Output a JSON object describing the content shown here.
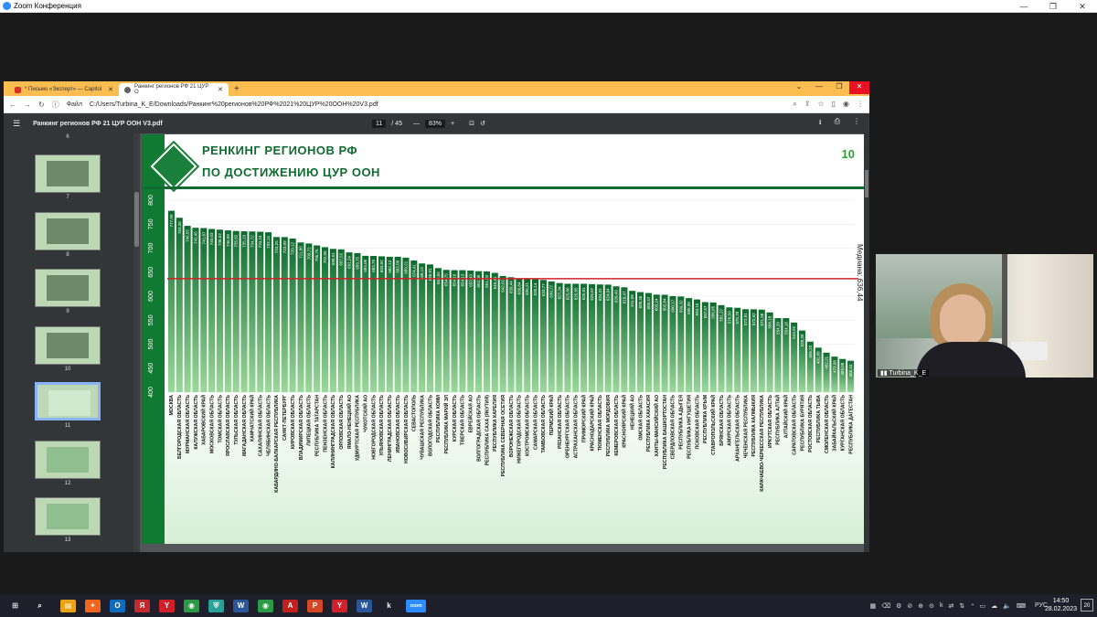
{
  "zoom_window": {
    "title": "Zoom Конференция",
    "min": "—",
    "max": "❐",
    "close": "✕"
  },
  "browser": {
    "tabs": [
      {
        "label": "* Письмо «Эксперт» — Capitol",
        "active": false,
        "color": "#d93025"
      },
      {
        "label": "Ранкинг регионов РФ 21 ЦУР О",
        "active": true,
        "color": "#5f6368"
      }
    ],
    "new_tab": "+",
    "address": {
      "scheme": "Файл",
      "url": "C:/Users/Turbina_K_E/Downloads/Ранкинг%20регионов%20РФ%2021%20ЦУР%20ООН%20V3.pdf"
    }
  },
  "pdf_toolbar": {
    "menu": "☰",
    "filename": "Ранкинг регионов РФ 21 ЦУР ООН V3.pdf",
    "page_current": "11",
    "page_total": "/ 45",
    "zoom_out": "—",
    "zoom": "83%",
    "zoom_in": "+",
    "download": "⭳",
    "print": "⎙",
    "more": "⋮"
  },
  "thumbnails": [
    {
      "label": "6",
      "top": true
    },
    {
      "label": "7"
    },
    {
      "label": "8"
    },
    {
      "label": "9"
    },
    {
      "label": "10"
    },
    {
      "label": "11",
      "active": true
    },
    {
      "label": "12"
    },
    {
      "label": "13"
    }
  ],
  "page": {
    "title_line1": "РЕНКИНГ РЕГИОНОВ РФ",
    "title_line2": "ПО ДОСТИЖЕНИЮ ЦУР ООН",
    "page_number": "10",
    "median_label": "Медиана: 636,44"
  },
  "chart_data": {
    "type": "bar",
    "ylim": [
      400,
      800
    ],
    "yticks": [
      400,
      450,
      500,
      550,
      600,
      650,
      700,
      750,
      800
    ],
    "median": 636.44,
    "colors": {
      "bar_top": "#0d6b2c",
      "bar_bottom": "#9ad99a",
      "median": "#d0202a"
    },
    "categories": [
      "МОСКВА",
      "БЕЛГОРОДСКАЯ ОБЛАСТЬ",
      "МУРМАНСКАЯ ОБЛАСТЬ",
      "КАЛУЖСКАЯ ОБЛАСТЬ",
      "ХАБАРОВСКИЙ КРАЙ",
      "МОСКОВСКАЯ ОБЛАСТЬ",
      "ТОМСКАЯ ОБЛАСТЬ",
      "ЯРОСЛАВСКАЯ ОБЛАСТЬ",
      "ТУЛЬСКАЯ ОБЛАСТЬ",
      "МАГАДАНСКАЯ ОБЛАСТЬ",
      "КАМЧАТСКИЙ КРАЙ",
      "САХАЛИНСКАЯ ОБЛАСТЬ",
      "ЧЕЛЯБИНСКАЯ ОБЛАСТЬ",
      "КАБАРДИНО-БАЛКАРСКАЯ РЕСПУБЛИКА",
      "САНКТ-ПЕТЕРБУРГ",
      "КИРОВСКАЯ ОБЛАСТЬ",
      "ВЛАДИМИРСКАЯ ОБЛАСТЬ",
      "ЛИПЕЦКАЯ ОБЛАСТЬ",
      "РЕСПУБЛИКА ТАТАРСТАН",
      "ПЕНЗЕНСКАЯ ОБЛАСТЬ",
      "КАЛИНИНГРАДСКАЯ ОБЛАСТЬ",
      "ОРЛОВСКАЯ ОБЛАСТЬ",
      "ЯМАЛО-НЕНЕЦКИЙ АО",
      "УДМУРТСКАЯ РЕСПУБЛИКА",
      "ЧУКОТСКИЙ АО",
      "НОВГОРОДСКАЯ ОБЛАСТЬ",
      "УЛЬЯНОВСКАЯ ОБЛАСТЬ",
      "ЛЕНИНГРАДСКАЯ ОБЛАСТЬ",
      "ИВАНОВСКАЯ ОБЛАСТЬ",
      "НОВОСИБИРСКАЯ ОБЛАСТЬ",
      "СЕВАСТОПОЛЬ",
      "ЧУВАШСКАЯ РЕСПУБЛИКА",
      "ВОЛОГОДСКАЯ ОБЛАСТЬ",
      "РЕСПУБЛИКА КОМИ",
      "РЕСПУБЛИКА МАРИЙ ЭЛ",
      "КУРСКАЯ ОБЛАСТЬ",
      "ТВЕРСКАЯ ОБЛАСТЬ",
      "ЕВРЕЙСКАЯ АО",
      "ВОЛГОГРАДСКАЯ ОБЛАСТЬ",
      "РЕСПУБЛИКА САХА (ЯКУТИЯ)",
      "РЕСПУБЛИКА КАРЕЛИЯ",
      "РЕСПУБЛИКА СЕВЕРНАЯ ОСЕТИЯ",
      "ВОРОНЕЖСКАЯ ОБЛАСТЬ",
      "НИЖЕГОРОДСКАЯ ОБЛАСТЬ",
      "КОСТРОМСКАЯ ОБЛАСТЬ",
      "САМАРСКАЯ ОБЛАСТЬ",
      "ТАМБОВСКАЯ ОБЛАСТЬ",
      "ПЕРМСКИЙ КРАЙ",
      "РЯЗАНСКАЯ ОБЛАСТЬ",
      "ОРЕНБУРГСКАЯ ОБЛАСТЬ",
      "АСТРАХАНСКАЯ ОБЛАСТЬ",
      "ПРИМОРСКИЙ КРАЙ",
      "КРАСНОДАРСКИЙ КРАЙ",
      "ТЮМЕНСКАЯ ОБЛАСТЬ",
      "РЕСПУБЛИКА МОРДОВИЯ",
      "КЕМЕРОВСКАЯ ОБЛАСТЬ",
      "КРАСНОЯРСКИЙ КРАЙ",
      "НЕНЕЦКИЙ АО",
      "ОМСКАЯ ОБЛАСТЬ",
      "РЕСПУБЛИКА ХАКАСИЯ",
      "ХАНТЫ-МАНСИЙСКИЙ АО",
      "РЕСПУБЛИКА БАШКОРТОСТАН",
      "СВЕРДЛОВСКАЯ ОБЛАСТЬ",
      "РЕСПУБЛИКА АДЫГЕЯ",
      "РЕСПУБЛИКА ИНГУШЕТИЯ",
      "ПСКОВСКАЯ ОБЛАСТЬ",
      "РЕСПУБЛИКА КРЫМ",
      "СТАВРОПОЛЬСКИЙ КРАЙ",
      "БРЯНСКАЯ ОБЛАСТЬ",
      "АМУРСКАЯ ОБЛАСТЬ",
      "АРХАНГЕЛЬСКАЯ ОБЛАСТЬ",
      "ЧЕЧЕНСКАЯ РЕСПУБЛИКА",
      "РЕСПУБЛИКА КАЛМЫКИЯ",
      "КАРАЧАЕВО-ЧЕРКЕССКАЯ РЕСПУБЛИКА",
      "ИРКУТСКАЯ ОБЛАСТЬ",
      "РЕСПУБЛИКА АЛТАЙ",
      "АЛТАЙСКИЙ КРАЙ",
      "САРАТОВСКАЯ ОБЛАСТЬ",
      "РЕСПУБЛИКА БУРЯТИЯ",
      "РОСТОВСКАЯ ОБЛАСТЬ",
      "РЕСПУБЛИКА ТЫВА",
      "СМОЛЕНСКАЯ ОБЛАСТЬ",
      "ЗАБАЙКАЛЬСКИЙ КРАЙ",
      "КУРГАНСКАЯ ОБЛАСТЬ",
      "РЕСПУБЛИКА ДАГЕСТАН"
    ],
    "values": [
      777.99,
      763.36,
      746.55,
      742.45,
      741.87,
      740.03,
      738.52,
      736.99,
      735.82,
      735.19,
      734.72,
      734.24,
      733.14,
      723.25,
      723.09,
      720.12,
      711.86,
      709.72,
      705.75,
      702.06,
      698.51,
      697.52,
      691.24,
      689.75,
      684.06,
      683.78,
      683.02,
      682.13,
      682.08,
      680.21,
      674.41,
      668.13,
      666.01,
      658.55,
      654.75,
      654.16,
      654.13,
      653.43,
      652.05,
      651.5,
      648.45,
      642.02,
      639.44,
      636.84,
      636.21,
      635.14,
      633.77,
      630.77,
      627.34,
      625.86,
      625.85,
      625.81,
      625.07,
      624.31,
      624.04,
      620.49,
      618.47,
      611.08,
      608.46,
      606.57,
      603.24,
      602.84,
      600.17,
      599.32,
      595.96,
      593.15,
      587.57,
      586.85,
      581.27,
      576.58,
      575.78,
      572.81,
      572.62,
      571.96,
      566.18,
      554.2,
      554.18,
      544.92,
      528.39,
      505.22,
      492.68,
      482.21,
      473.98,
      469.08,
      465.44
    ]
  },
  "video": {
    "name": "Turbina_K_E"
  },
  "taskbar": {
    "apps": [
      {
        "label": "⊞",
        "color": "transparent"
      },
      {
        "label": "⌕",
        "color": "transparent"
      },
      {
        "label": "▤",
        "color": "#e8a317"
      },
      {
        "label": "✦",
        "color": "#f0661f"
      },
      {
        "label": "O",
        "color": "#0f6cbd"
      },
      {
        "label": "Я",
        "color": "#c2292e"
      },
      {
        "label": "Y",
        "color": "#d0202a"
      },
      {
        "label": "◉",
        "color": "#2b9a46"
      },
      {
        "label": "⛨",
        "color": "#2aa198"
      },
      {
        "label": "W",
        "color": "#2b579a"
      },
      {
        "label": "◉",
        "color": "#2b9a46"
      },
      {
        "label": "A",
        "color": "#c21f1f"
      },
      {
        "label": "P",
        "color": "#d24726"
      },
      {
        "label": "Y",
        "color": "#d0202a"
      },
      {
        "label": "W",
        "color": "#2b579a"
      },
      {
        "label": "k",
        "color": "transparent"
      },
      {
        "label": "zoom",
        "color": "#2d8cff"
      }
    ],
    "tray": [
      "▦",
      "⌫",
      "⚙",
      "⊘",
      "⊕",
      "⊝",
      "k",
      "⇄",
      "⇅",
      "◔",
      "▭",
      "☁",
      "🔈",
      "⌨"
    ],
    "lang": "РУС",
    "time": "14:50",
    "date": "28.02.2023",
    "notif": "20"
  }
}
